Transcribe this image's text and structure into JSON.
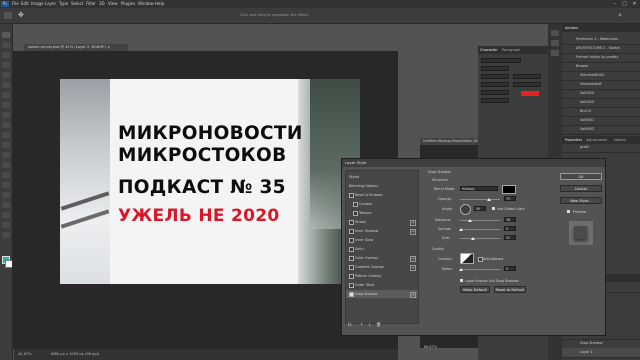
{
  "app": {
    "logo": "Ps"
  },
  "menu": [
    "File",
    "Edit",
    "Image",
    "Layer",
    "Type",
    "Select",
    "Filter",
    "3D",
    "View",
    "Plugins",
    "Window",
    "Help"
  ],
  "window_controls": [
    "–",
    "□",
    "✕"
  ],
  "options_bar": {
    "hint": "Click and drag to reposition the effect."
  },
  "document": {
    "tab_label": "splash-empty.psd @ 42% (Layer 2, RGB/8*) ×",
    "zoom": "42,67%",
    "doc_info": "1680 px x 1050 px (96 ppi)"
  },
  "artwork": {
    "lines": [
      "МИКРОНОВОСТИ",
      "МИКРОСТОКОВ",
      "ПОДКАСТ № 35"
    ],
    "red_line": "УЖЕЛЬ НЕ 2020",
    "accent_color": "#d8172a"
  },
  "secondary_doc": {
    "tab_label": "Untitled-Mockup-Dissertation-Gh.png @ 66,7% (Rec...",
    "zoom": "66,67%"
  },
  "panels": {
    "character_tab": "Character",
    "paragraph_tab": "Paragraph",
    "actions_title": "Actions",
    "actions": [
      "Perfectum 2 - Watercolor",
      "ARCHITECTURE 2 - Sketch",
      "Portrait Action by proddy",
      "Browse",
      "Stitched4fuDX",
      "Shadowsdsff",
      "Sat0020",
      "Sat0010",
      "Blur10",
      "Sat0001",
      "Sat0002",
      "TestHeader",
      "gratii"
    ],
    "properties_tab": "Properties",
    "adjustments_tab": "Adjustments",
    "history_tab": "History",
    "layers_title": "Layers",
    "layer_items": [
      "Find Layer",
      "Effects",
      "Drop Shadow",
      "Layer 1"
    ]
  },
  "dialog": {
    "title": "Layer Style",
    "styles_header": "Styles",
    "blending": "Blending Options",
    "styles": [
      {
        "label": "Bevel & Emboss",
        "plus": false,
        "checked": false
      },
      {
        "label": "Contour",
        "plus": false,
        "checked": false
      },
      {
        "label": "Texture",
        "plus": false,
        "checked": false
      },
      {
        "label": "Stroke",
        "plus": true,
        "checked": false
      },
      {
        "label": "Inner Shadow",
        "plus": true,
        "checked": false
      },
      {
        "label": "Inner Glow",
        "plus": false,
        "checked": false
      },
      {
        "label": "Satin",
        "plus": false,
        "checked": false
      },
      {
        "label": "Color Overlay",
        "plus": true,
        "checked": false
      },
      {
        "label": "Gradient Overlay",
        "plus": true,
        "checked": false
      },
      {
        "label": "Pattern Overlay",
        "plus": false,
        "checked": false
      },
      {
        "label": "Outer Glow",
        "plus": false,
        "checked": false
      },
      {
        "label": "Drop Shadow",
        "plus": true,
        "checked": true
      }
    ],
    "fx_icons": [
      "fx",
      "↑",
      "↓",
      "🗑"
    ],
    "section": "Drop Shadow",
    "structure": "Structure",
    "blend_mode_label": "Blend Mode:",
    "blend_mode": "Multiply",
    "opacity_label": "Opacity:",
    "opacity": "75",
    "angle_label": "Angle:",
    "angle": "90",
    "global_light": "Use Global Light",
    "distance_label": "Distance:",
    "distance": "18",
    "spread_label": "Spread:",
    "spread": "0",
    "size_label": "Size:",
    "size": "51",
    "quality": "Quality",
    "contour_label": "Contour:",
    "anti_aliased": "Anti-aliased",
    "noise_label": "Noise:",
    "noise": "0",
    "knockout": "Layer Knocks Out Drop Shadow",
    "make_default": "Make Default",
    "reset_default": "Reset to Default",
    "ok": "OK",
    "cancel": "Cancel",
    "new_style": "New Style...",
    "preview": "Preview"
  }
}
